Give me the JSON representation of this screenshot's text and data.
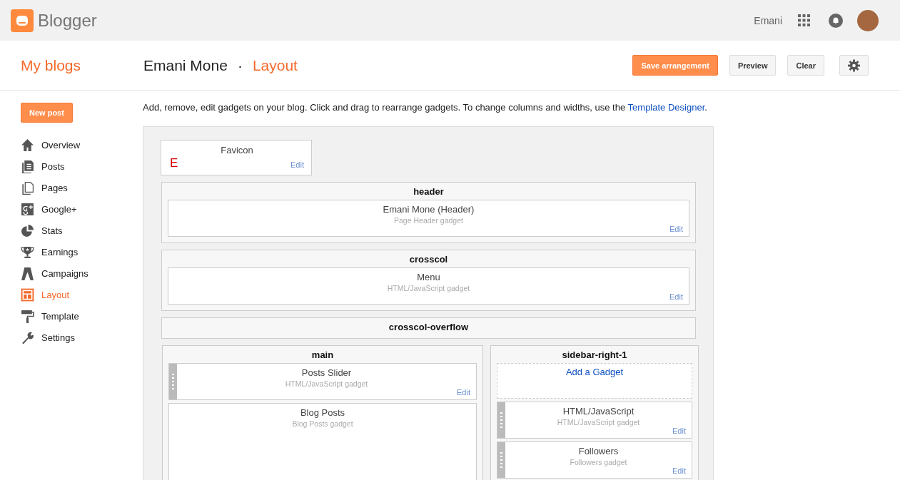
{
  "topbar": {
    "logo_text": "Blogger",
    "user_name": "Emani"
  },
  "header": {
    "section_title": "My blogs",
    "blog_name": "Emani Mone",
    "separator": "·",
    "page_title": "Layout",
    "buttons": [
      {
        "kind": "primary",
        "label": "Save arrangement"
      },
      {
        "kind": "default",
        "label": "Preview"
      },
      {
        "kind": "default",
        "label": "Clear"
      },
      {
        "kind": "settings"
      }
    ]
  },
  "sidebar": {
    "new_post": "New post",
    "items": [
      {
        "label": "Overview",
        "selected": false
      },
      {
        "label": "Posts",
        "selected": false
      },
      {
        "label": "Pages",
        "selected": false
      },
      {
        "label": "Google+",
        "selected": false
      },
      {
        "label": "Stats",
        "selected": false
      },
      {
        "label": "Earnings",
        "selected": false
      },
      {
        "label": "Campaigns",
        "selected": false
      },
      {
        "label": "Layout",
        "selected": true
      },
      {
        "label": "Template",
        "selected": false
      },
      {
        "label": "Settings",
        "selected": false
      }
    ]
  },
  "layout": {
    "intro": "Add, remove, edit gadgets on your blog. Click and drag to rearrange gadgets. To change columns and widths, use the",
    "intro_link": "Template Designer",
    "intro_end": ".",
    "favicon": {
      "title": "Favicon",
      "glyph": "E",
      "edit": "Edit"
    },
    "sections": [
      {
        "name": "header",
        "gadgets": [
          {
            "title": "Emani Mone (Header)",
            "subtitle": "Page Header gadget",
            "edit": "Edit",
            "draggable": false
          }
        ]
      },
      {
        "name": "crosscol",
        "gadgets": [
          {
            "title": "Menu",
            "subtitle": "HTML/JavaScript gadget",
            "edit": "Edit",
            "draggable": false
          }
        ]
      },
      {
        "name": "crosscol-overflow"
      }
    ],
    "columns": [
      {
        "name": "main",
        "gadgets": [
          {
            "title": "Posts Slider",
            "subtitle": "HTML/JavaScript gadget",
            "edit": "Edit",
            "draggable": true
          },
          {
            "title": "Blog Posts",
            "subtitle": "Blog Posts gadget",
            "draggable": false
          }
        ]
      },
      {
        "name": "sidebar-right-1",
        "add_gadget": "Add a Gadget",
        "gadgets": [
          {
            "title": "HTML/JavaScript",
            "subtitle": "HTML/JavaScript gadget",
            "edit": "Edit",
            "draggable": true
          },
          {
            "title": "Followers",
            "subtitle": "Followers gadget",
            "edit": "Edit",
            "draggable": true
          }
        ]
      }
    ]
  }
}
